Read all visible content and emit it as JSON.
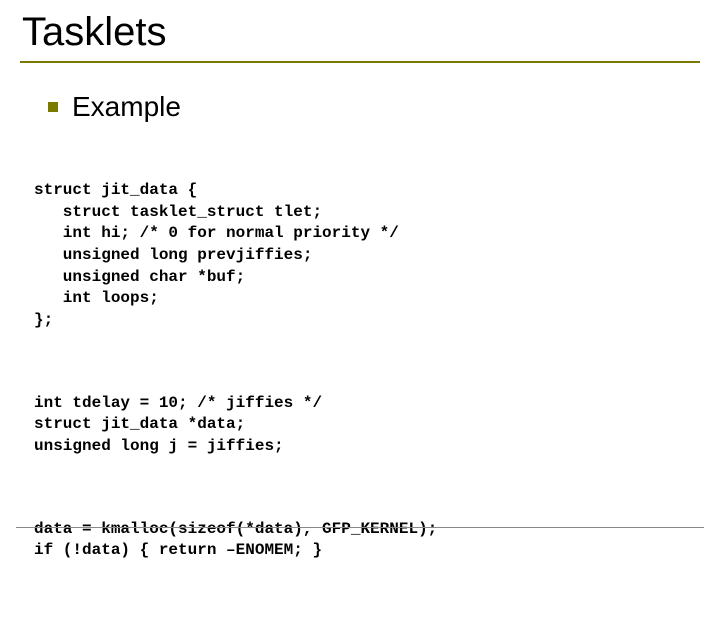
{
  "slide": {
    "title": "Tasklets",
    "example_label": "Example",
    "code": {
      "block1": "struct jit_data {\n   struct tasklet_struct tlet;\n   int hi; /* 0 for normal priority */\n   unsigned long prevjiffies;\n   unsigned char *buf;\n   int loops;\n};",
      "block2": "int tdelay = 10; /* jiffies */\nstruct jit_data *data;\nunsigned long j = jiffies;",
      "block3": "data = kmalloc(sizeof(*data), GFP_KERNEL);\nif (!data) { return –ENOMEM; }"
    }
  }
}
